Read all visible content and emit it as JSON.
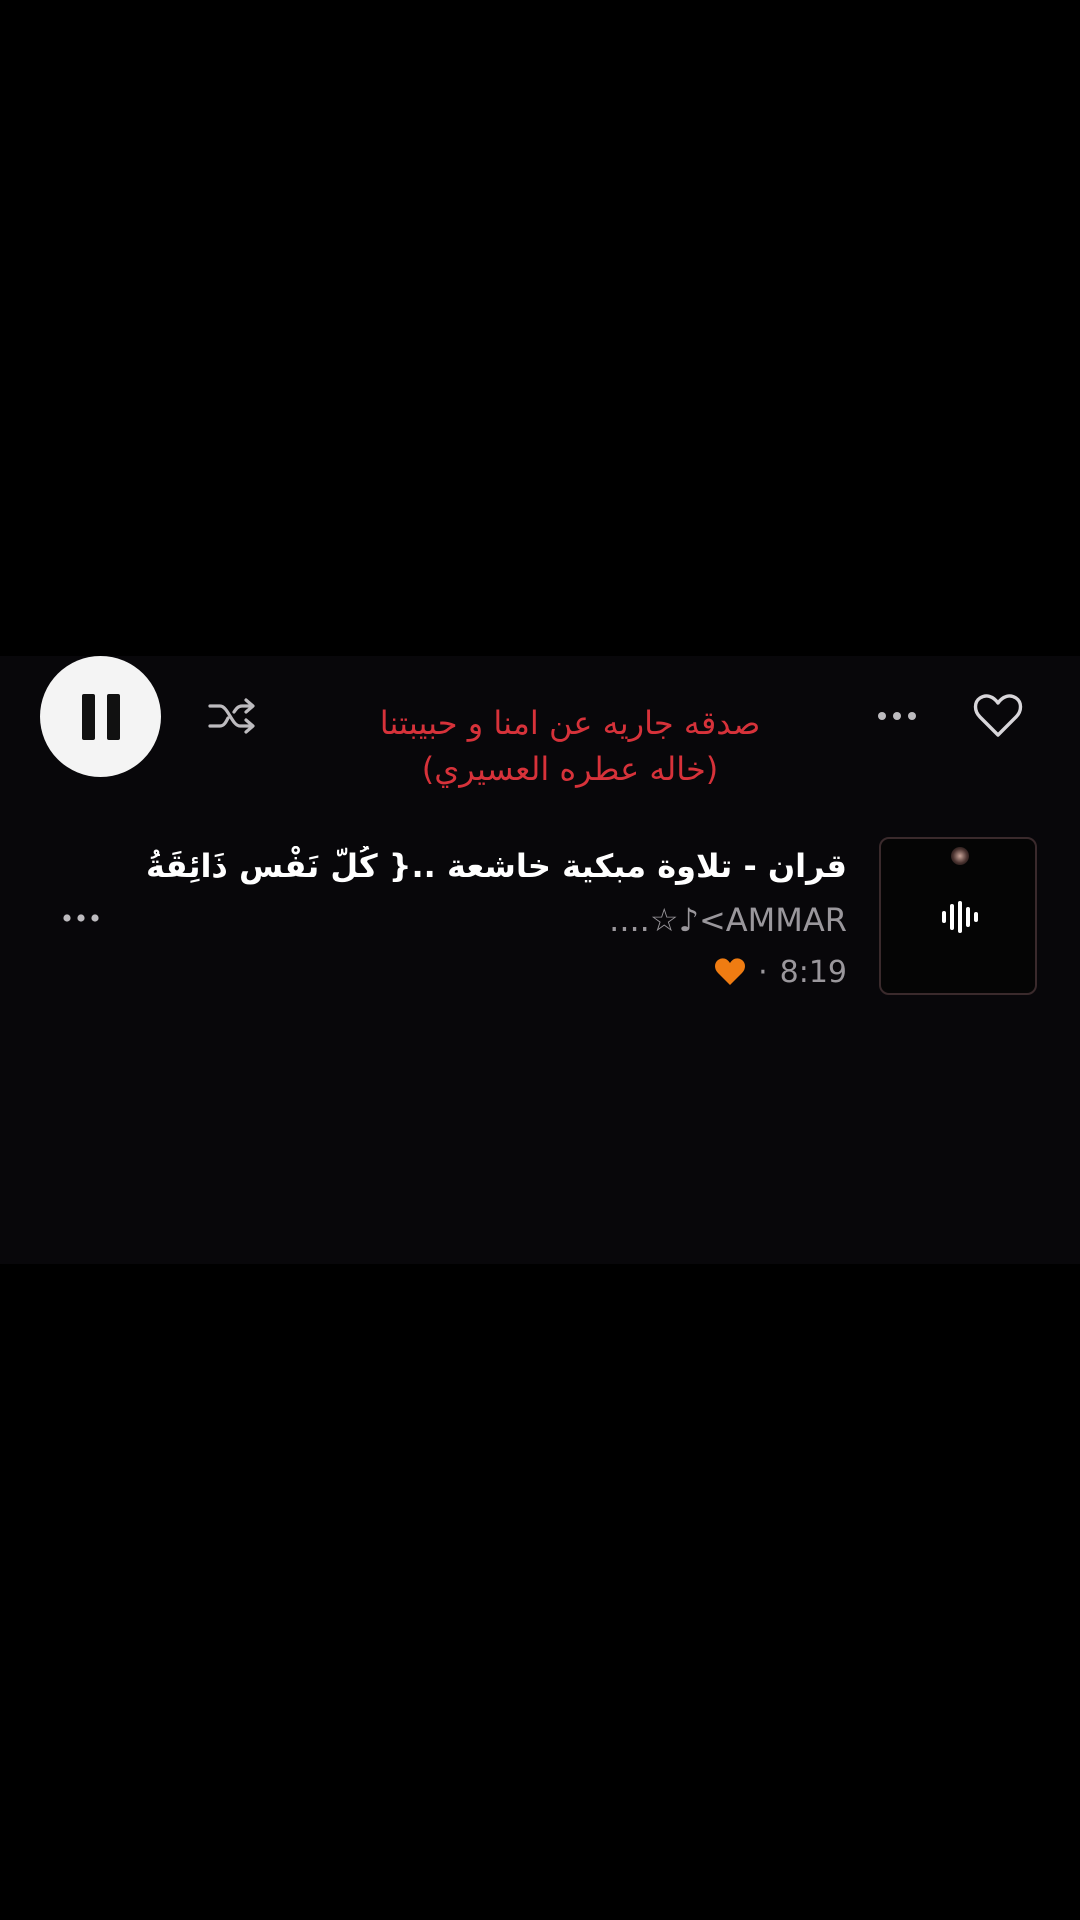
{
  "player": {
    "pause_label": "Pause",
    "shuffle_icon": "shuffle-icon",
    "playlist_title_line1": "صدقه جاريه عن امنا و حبيبتنا",
    "playlist_title_line2": "(خاله عطره العسيري)",
    "title_color": "#d7323a"
  },
  "track": {
    "title": "قران -  تلاوة مبكية خاشعة ..{ كُلّ نَفْسٍ ذَائِقَةُ الْ...",
    "artist": "....☆♪<AMMAR",
    "duration": "8:19",
    "separator": "·",
    "liked_color": "#ef7c12"
  },
  "icons": {
    "like": "heart-outline-icon",
    "more": "more-horizontal-icon",
    "now_playing": "waveform-icon"
  }
}
